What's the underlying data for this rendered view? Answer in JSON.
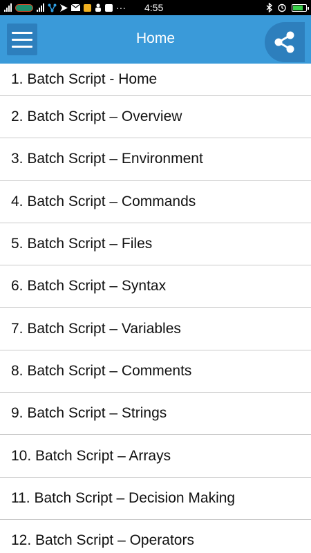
{
  "status_bar": {
    "time": "4:55",
    "overflow": "···",
    "icons": [
      "signal-icon",
      "carrier-logo-icon",
      "signal-icon",
      "share-network-icon",
      "send-icon",
      "mail-icon",
      "notification-icon",
      "user-icon",
      "facebook-icon",
      "bluetooth-icon",
      "alarm-icon",
      "battery-icon"
    ],
    "battery_level": 0.85,
    "colors": {
      "background": "#000000",
      "battery_fill": "#3ad04a"
    }
  },
  "app_bar": {
    "title": "Home",
    "menu_icon": "hamburger-menu-icon",
    "share_icon": "share-icon",
    "colors": {
      "background": "#3a9ad9",
      "button": "#2d7fbd"
    }
  },
  "list": {
    "items": [
      "1. Batch Script - Home",
      "2. Batch Script – Overview",
      "3. Batch Script – Environment",
      "4. Batch Script – Commands",
      "5. Batch Script – Files",
      "6. Batch Script – Syntax",
      "7. Batch Script – Variables",
      "8. Batch Script – Comments",
      "9. Batch Script – Strings",
      "10. Batch Script – Arrays",
      "11. Batch Script – Decision Making",
      "12. Batch Script – Operators"
    ]
  }
}
